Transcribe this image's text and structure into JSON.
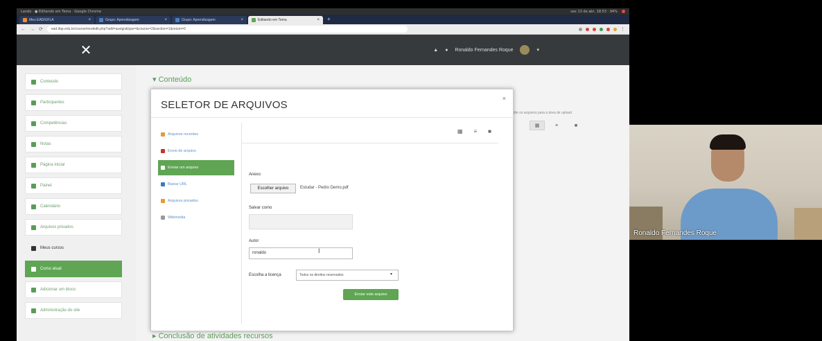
{
  "os_bar": {
    "left_text": "Lando · ● Editando em Tema · Google Chrome",
    "right_text": "sex 13 de abr, 18:53 · 94%"
  },
  "browser": {
    "tabs": [
      {
        "label": "Meu EAD/UFLA"
      },
      {
        "label": "Grupo: Aprendizagem"
      },
      {
        "label": "Grupo: Aprendizagem"
      },
      {
        "label": "Editando em Tema"
      }
    ],
    "url": "ead.ifap.edu.br/course/modedit.php?add=assign&type=&course=2&section=1&return=0"
  },
  "moodle": {
    "menu_close_glyph": "✕",
    "nav_user": "Ronaldo Fernandes Roque",
    "drawer": [
      {
        "label": "Conteúdo",
        "state": "normal"
      },
      {
        "label": "Participantes",
        "state": "normal"
      },
      {
        "label": "Competências",
        "state": "normal"
      },
      {
        "label": "Notas",
        "state": "normal"
      },
      {
        "label": "Página inicial",
        "state": "normal"
      },
      {
        "label": "Painel",
        "state": "normal"
      },
      {
        "label": "Calendário",
        "state": "normal"
      },
      {
        "label": "Arquivos privados",
        "state": "normal"
      },
      {
        "label": "Meus cursos",
        "state": "plain"
      },
      {
        "label": "Curso atual",
        "state": "active"
      },
      {
        "label": "Adicionar um bloco",
        "state": "normal"
      },
      {
        "label": "Administração do site",
        "state": "normal"
      }
    ],
    "section_top": "Conteúdo",
    "section_bottom": "Conclusão de atividades recursos",
    "bg_hint": "arraste e solte os arquivos para a área de upload"
  },
  "file_picker": {
    "title": "SELETOR DE ARQUIVOS",
    "close": "×",
    "repositories": [
      {
        "label": "Arquivos recentes",
        "active": false
      },
      {
        "label": "Envio de arquivo",
        "active": false
      },
      {
        "label": "Enviar um arquivo",
        "active": true
      },
      {
        "label": "Baixar URL",
        "active": false
      },
      {
        "label": "Arquivos privados",
        "active": false
      },
      {
        "label": "Wikimedia",
        "active": false
      }
    ],
    "view_icons": [
      "grid-view-icon",
      "list-view-icon",
      "folder-view-icon"
    ],
    "attachment_label": "Anexo",
    "choose_button": "Escolher arquivo",
    "chosen_file": "Estudar - Pedro Demo.pdf",
    "save_as_label": "Salvar como",
    "save_as_value": "",
    "author_label": "Autor",
    "author_value": "ronaldo",
    "license_label": "Escolha a licença",
    "license_value": "Todos os direitos reservados",
    "upload_button": "Enviar este arquivo"
  },
  "webcam": {
    "participant_name": "Ronaldo Fernandes Roque"
  }
}
